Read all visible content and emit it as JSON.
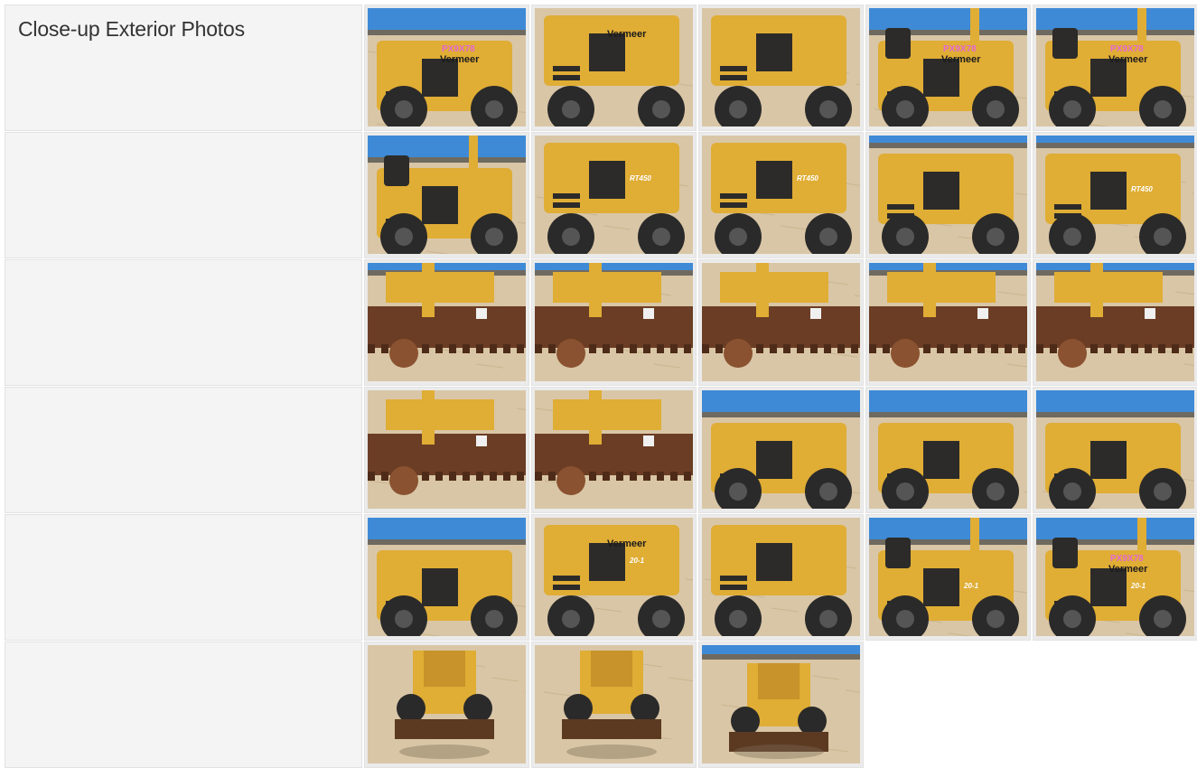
{
  "section": {
    "title": "Close-up Exterior Photos"
  },
  "palette": {
    "sky": "#3f8ad6",
    "ground": "#d9c6a6",
    "machine_yellow": "#e0ad35",
    "machine_dark": "#2c2b29",
    "tire": "#2a2a2a",
    "rust": "#6b3d24",
    "cell_bg": "#f4f4f4",
    "border": "#e2e2e2"
  },
  "rows": [
    {
      "photos": [
        {
          "id": "p1",
          "view": "side-decal",
          "decal": "PX9X78",
          "brand": "Vermeer"
        },
        {
          "id": "p2",
          "view": "front-tire",
          "brand": "Vermeer"
        },
        {
          "id": "p3",
          "view": "tire-step"
        },
        {
          "id": "p4",
          "view": "seat-decal",
          "decal": "PX9X78",
          "brand": "Vermeer"
        },
        {
          "id": "p5",
          "view": "seat-decal",
          "decal": "PX9X78",
          "brand": "Vermeer"
        }
      ]
    },
    {
      "photos": [
        {
          "id": "p6",
          "view": "rear-seat"
        },
        {
          "id": "p7",
          "view": "side-model",
          "model": "RT450"
        },
        {
          "id": "p8",
          "view": "side-model",
          "model": "RT450"
        },
        {
          "id": "p9",
          "view": "frame"
        },
        {
          "id": "p10",
          "view": "frame",
          "model": "RT450"
        }
      ]
    },
    {
      "photos": [
        {
          "id": "p11",
          "view": "trencher"
        },
        {
          "id": "p12",
          "view": "trencher"
        },
        {
          "id": "p13",
          "view": "trencher-ground"
        },
        {
          "id": "p14",
          "view": "trencher"
        },
        {
          "id": "p15",
          "view": "trencher"
        }
      ]
    },
    {
      "photos": [
        {
          "id": "p16",
          "view": "boom"
        },
        {
          "id": "p17",
          "view": "boom"
        },
        {
          "id": "p18",
          "view": "boom-sky"
        },
        {
          "id": "p19",
          "view": "boom-sky"
        },
        {
          "id": "p20",
          "view": "side-plow"
        }
      ]
    },
    {
      "photos": [
        {
          "id": "p21",
          "view": "side-plow"
        },
        {
          "id": "p22",
          "view": "front-tire",
          "brand": "Vermeer",
          "model": "20-1"
        },
        {
          "id": "p23",
          "view": "tire-step"
        },
        {
          "id": "p24",
          "view": "rear-seat",
          "model": "20-1"
        },
        {
          "id": "p25",
          "view": "seat-decal",
          "decal": "PX9X78",
          "brand": "Vermeer",
          "model": "20-1"
        }
      ]
    },
    {
      "photos": [
        {
          "id": "p26",
          "view": "blade-ground"
        },
        {
          "id": "p27",
          "view": "blade-ground"
        },
        {
          "id": "p28",
          "view": "blade-sky"
        }
      ]
    }
  ]
}
